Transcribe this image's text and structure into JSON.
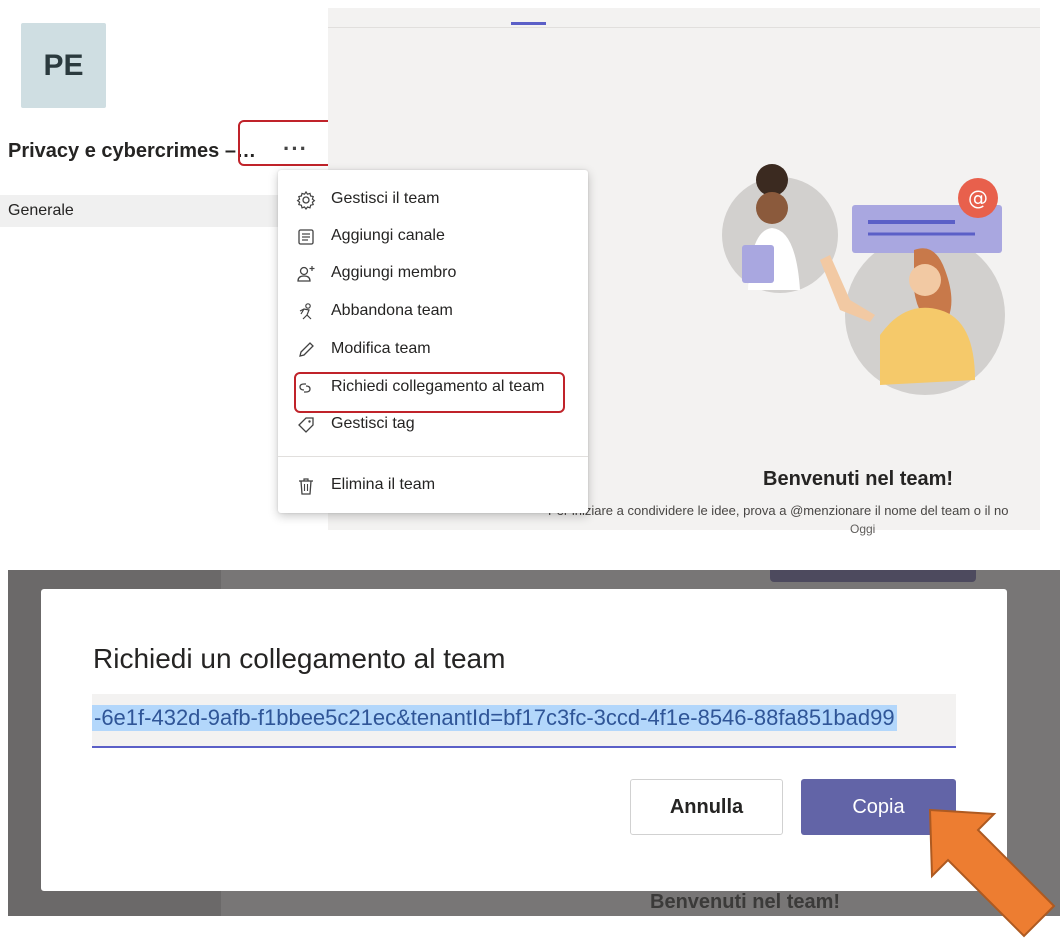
{
  "team": {
    "avatar_initials": "PE",
    "name": "Privacy e cybercrimes –…",
    "more_label": "···"
  },
  "channels": [
    {
      "label": "Generale"
    }
  ],
  "menu": {
    "items": [
      {
        "label": "Gestisci il team",
        "icon": "gear-icon"
      },
      {
        "label": "Aggiungi canale",
        "icon": "channel-list-icon"
      },
      {
        "label": "Aggiungi membro",
        "icon": "add-person-icon"
      },
      {
        "label": "Abbandona team",
        "icon": "leave-team-icon"
      },
      {
        "label": "Modifica team",
        "icon": "pencil-icon"
      },
      {
        "label": "Richiedi collegamento al team",
        "icon": "link-icon"
      },
      {
        "label": "Gestisci tag",
        "icon": "tag-icon"
      },
      {
        "label": "Elimina il team",
        "icon": "trash-icon"
      }
    ]
  },
  "welcome": {
    "title": "Benvenuti nel team!",
    "subtitle": "Per iniziare a condividere le idee, prova a @menzionare il nome del team o il no",
    "today": "Oggi"
  },
  "dialog": {
    "title": "Richiedi un collegamento al team",
    "link_value": "-6e1f-432d-9afb-f1bbee5c21ec&tenantId=bf17c3fc-3ccd-4f1e-8546-88fa851bad99",
    "cancel_label": "Annulla",
    "copy_label": "Copia"
  },
  "background_welcome": "Benvenuti nel team!",
  "colors": {
    "accent": "#6264a7",
    "highlight_box": "#c0232a",
    "annotation_arrow": "#ed7d31",
    "selection": "#b3d7fb"
  }
}
